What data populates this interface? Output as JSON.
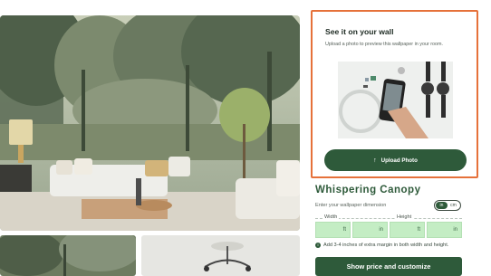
{
  "panel": {
    "title": "See it on your wall",
    "subtitle": "Upload a photo to preview this wallpaper in your room.",
    "upload_icon": "arrow-up-icon",
    "upload_label": "Upload Photo"
  },
  "product": {
    "title": "Whispering Canopy",
    "dimension_label": "Enter your wallpaper dimension",
    "units": [
      "in",
      "cm"
    ],
    "selected_unit": "in",
    "width_label": "Width",
    "height_label": "Height",
    "width_ft_unit": "ft",
    "width_in_unit": "in",
    "height_ft_unit": "ft",
    "height_in_unit": "in",
    "hint_icon": "info-icon",
    "hint": "Add 3-4 inches of extra margin in both width and height.",
    "cta_label": "Show price and customize"
  },
  "colors": {
    "brand_green": "#2e5a3a",
    "input_green": "#c4edc4",
    "highlight_border": "#e6713a"
  }
}
